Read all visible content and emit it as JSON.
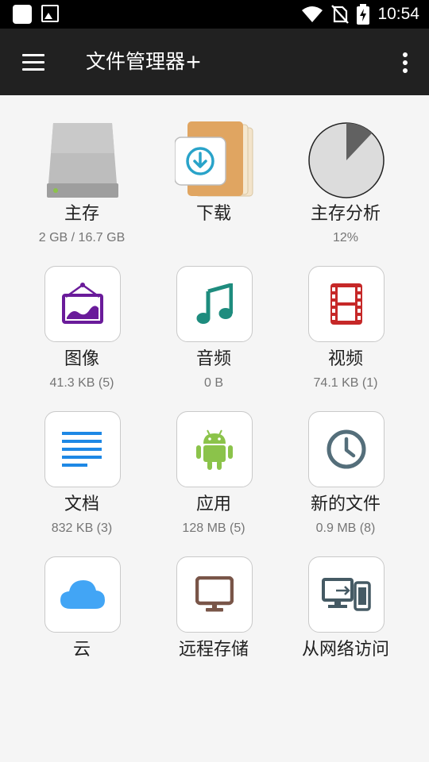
{
  "status_bar": {
    "time": "10:54",
    "icons": [
      "notification-icon",
      "image-icon",
      "wifi-icon",
      "no-sim-icon",
      "battery-charging-icon"
    ]
  },
  "app_bar": {
    "title": "文件管理器+",
    "menu_icon": "hamburger-menu-icon",
    "overflow_icon": "more-vert-icon"
  },
  "tiles": [
    {
      "label": "主存",
      "sub": "2 GB / 16.7 GB",
      "icon": "hard-drive-icon"
    },
    {
      "label": "下载",
      "sub": "",
      "icon": "download-folder-icon"
    },
    {
      "label": "主存分析",
      "sub": "12%",
      "icon": "pie-chart-icon",
      "used_fraction": 0.12
    },
    {
      "label": "图像",
      "sub": "41.3 KB (5)",
      "icon": "image-frame-icon",
      "color": "#6a1b9a"
    },
    {
      "label": "音频",
      "sub": "0 B",
      "icon": "music-note-icon",
      "color": "#1e8c7e"
    },
    {
      "label": "视频",
      "sub": "74.1 KB (1)",
      "icon": "film-strip-icon",
      "color": "#c62828"
    },
    {
      "label": "文档",
      "sub": "832 KB (3)",
      "icon": "document-lines-icon",
      "color": "#1e88e5"
    },
    {
      "label": "应用",
      "sub": "128 MB (5)",
      "icon": "android-icon",
      "color": "#8bc34a"
    },
    {
      "label": "新的文件",
      "sub": "0.9 MB (8)",
      "icon": "clock-icon",
      "color": "#546e7a"
    },
    {
      "label": "云",
      "sub": "",
      "icon": "cloud-icon",
      "color": "#42a5f5"
    },
    {
      "label": "远程存储",
      "sub": "",
      "icon": "monitor-icon",
      "color": "#795548"
    },
    {
      "label": "从网络访问",
      "sub": "",
      "icon": "devices-icon",
      "color": "#455a64"
    }
  ]
}
